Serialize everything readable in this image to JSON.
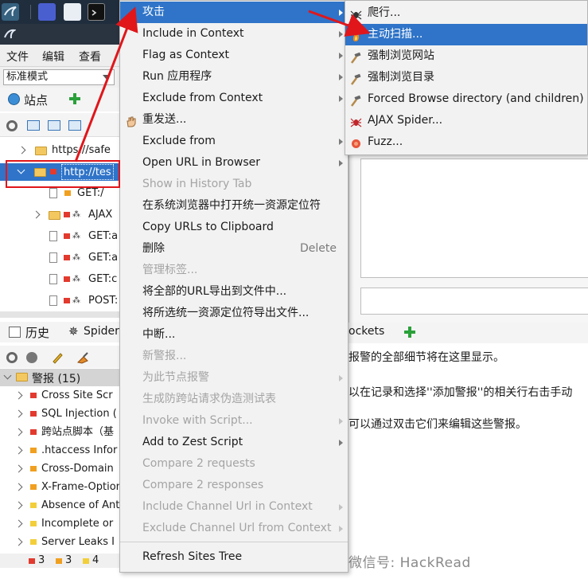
{
  "menubar": {
    "file": "文件",
    "edit": "编辑",
    "view": "查看"
  },
  "mode": {
    "selected": "标准模式"
  },
  "sites_tab": {
    "label": "站点"
  },
  "tree": {
    "nodes": [
      {
        "label": "https://safe",
        "kind": "folder"
      },
      {
        "label": "http://tes",
        "kind": "folder",
        "selected": true
      },
      {
        "label": "GET:/",
        "kind": "doc"
      },
      {
        "label": "AJAX",
        "kind": "folder"
      },
      {
        "label": "GET:a",
        "kind": "doc"
      },
      {
        "label": "GET:a",
        "kind": "doc"
      },
      {
        "label": "GET:c",
        "kind": "doc"
      },
      {
        "label": "POST:",
        "kind": "doc"
      }
    ]
  },
  "bottom_tabs": {
    "history": "历史",
    "spider": "Spider",
    "websockets": "ockets"
  },
  "alerts": {
    "header": "警报 (15)",
    "items": [
      {
        "label": "Cross Site Scr",
        "color": "#e23a2e"
      },
      {
        "label": "SQL Injection (",
        "color": "#e23a2e"
      },
      {
        "label": "跨站点脚本（基",
        "color": "#e23a2e"
      },
      {
        "label": ".htaccess Infor",
        "color": "#f0a020"
      },
      {
        "label": "Cross-Domain",
        "color": "#f0a020"
      },
      {
        "label": "X-Frame-Option",
        "color": "#f0a020"
      },
      {
        "label": "Absence of Ant",
        "color": "#f2cf3a"
      },
      {
        "label": "Incomplete or",
        "color": "#f2cf3a"
      },
      {
        "label": "Server Leaks I",
        "color": "#f2cf3a"
      }
    ]
  },
  "status": {
    "high": "3",
    "med": "3",
    "low": "4"
  },
  "alert_detail": {
    "line1": "报警的全部细节将在这里显示。",
    "line2": "以在记录和选择''添加警报''的相关行右击手动",
    "line3": "可以通过双击它们来编辑这些警报。"
  },
  "watermark": "微信号: HackRead",
  "context_menu": {
    "items": [
      {
        "label": "攻击",
        "submenu": true,
        "highlighted": true
      },
      {
        "label": "Include in Context",
        "submenu": true
      },
      {
        "label": "Flag as Context",
        "submenu": true
      },
      {
        "label": "Run 应用程序",
        "submenu": true
      },
      {
        "label": "Exclude from Context",
        "submenu": true
      },
      {
        "label": "重发送...",
        "icon": "hand-icon"
      },
      {
        "label": "Exclude from",
        "submenu": true
      },
      {
        "label": "Open URL in Browser",
        "submenu": true
      },
      {
        "label": "Show in History Tab",
        "disabled": true
      },
      {
        "label": "在系统浏览器中打开统一资源定位符"
      },
      {
        "label": "Copy URLs to Clipboard"
      },
      {
        "label": "删除",
        "accelerator": "Delete"
      },
      {
        "label": "管理标签...",
        "disabled": true
      },
      {
        "label": "将全部的URL导出到文件中..."
      },
      {
        "label": "将所选统一资源定位符导出文件..."
      },
      {
        "label": "中断..."
      },
      {
        "label": "新警报...",
        "disabled": true
      },
      {
        "label": "为此节点报警",
        "disabled": true,
        "submenu": true
      },
      {
        "label": "生成防跨站请求伪造测试表",
        "disabled": true
      },
      {
        "label": "Invoke with Script...",
        "disabled": true,
        "submenu": true
      },
      {
        "label": "Add to Zest Script",
        "submenu": true
      },
      {
        "label": "Compare 2 requests",
        "disabled": true
      },
      {
        "label": "Compare 2 responses",
        "disabled": true
      },
      {
        "label": "Include Channel Url in Context",
        "disabled": true,
        "submenu": true
      },
      {
        "label": "Exclude Channel Url from Context",
        "disabled": true,
        "submenu": true
      },
      {
        "label": "Refresh Sites Tree"
      }
    ]
  },
  "attack_submenu": {
    "items": [
      {
        "label": "爬行...",
        "icon": "spider-icon"
      },
      {
        "label": "主动扫描...",
        "icon": "flame-icon",
        "highlighted": true
      },
      {
        "label": "强制浏览网站",
        "icon": "hammer-icon"
      },
      {
        "label": "强制浏览目录",
        "icon": "hammer-icon"
      },
      {
        "label": "Forced Browse directory (and children)",
        "icon": "hammer-icon"
      },
      {
        "label": "AJAX Spider...",
        "icon": "ajax-spider-icon"
      },
      {
        "label": "Fuzz...",
        "icon": "fuzz-icon"
      }
    ]
  },
  "colors": {
    "highlight": "#2f74c8",
    "annotation": "#e0161b"
  }
}
